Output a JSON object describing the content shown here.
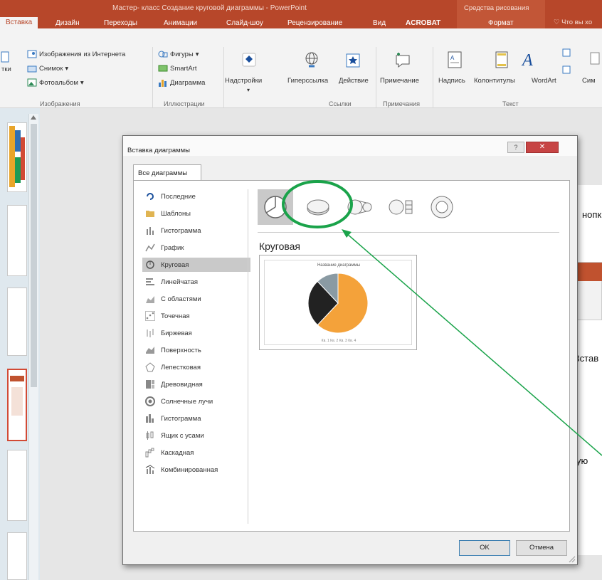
{
  "window": {
    "title": "Мастер- класс Создание круговой диаграммы - PowerPoint",
    "context_group": "Средства рисования",
    "tell_me": "Что вы хо"
  },
  "tabs": [
    {
      "label": "Вставка",
      "active": true
    },
    {
      "label": "Дизайн"
    },
    {
      "label": "Переходы"
    },
    {
      "label": "Анимации"
    },
    {
      "label": "Слайд-шоу"
    },
    {
      "label": "Рецензирование"
    },
    {
      "label": "Вид"
    },
    {
      "label": "ACROBAT"
    },
    {
      "label": "Формат"
    }
  ],
  "ribbon": {
    "images": {
      "online_pictures": "Изображения из Интернета",
      "screenshot": "Снимок",
      "photo_album": "Фотоальбом",
      "left_cut": "тки",
      "group": "Изображения"
    },
    "illustrations": {
      "shapes": "Фигуры",
      "smartart": "SmartArt",
      "chart": "Диаграмма",
      "group": "Иллюстрации"
    },
    "addins": {
      "label": "Надстройки"
    },
    "links": {
      "hyperlink": "Гиперссылка",
      "action": "Действие",
      "group": "Ссылки"
    },
    "comments": {
      "comment": "Примечание",
      "group": "Примечания"
    },
    "text": {
      "textbox": "Надпись",
      "header_footer": "Колонтитулы",
      "wordart": "WordArt",
      "symbols": "Сим",
      "group": "Текст"
    }
  },
  "slide": {
    "text1": "нопк",
    "text2": "Встав",
    "text3": "ую"
  },
  "dialog": {
    "title": "Вставка диаграммы",
    "help": "?",
    "close": "✕",
    "tab": "Все диаграммы",
    "categories": [
      {
        "label": "Последние",
        "icon": "recent-icon"
      },
      {
        "label": "Шаблоны",
        "icon": "folder-icon"
      },
      {
        "label": "Гистограмма",
        "icon": "column-chart-icon"
      },
      {
        "label": "График",
        "icon": "line-chart-icon"
      },
      {
        "label": "Круговая",
        "icon": "pie-chart-icon",
        "selected": true
      },
      {
        "label": "Линейчатая",
        "icon": "bar-chart-icon"
      },
      {
        "label": "С областями",
        "icon": "area-chart-icon"
      },
      {
        "label": "Точечная",
        "icon": "scatter-chart-icon"
      },
      {
        "label": "Биржевая",
        "icon": "stock-chart-icon"
      },
      {
        "label": "Поверхность",
        "icon": "surface-chart-icon"
      },
      {
        "label": "Лепестковая",
        "icon": "radar-chart-icon"
      },
      {
        "label": "Древовидная",
        "icon": "treemap-chart-icon"
      },
      {
        "label": "Солнечные лучи",
        "icon": "sunburst-chart-icon"
      },
      {
        "label": "Гистограмма",
        "icon": "histogram-chart-icon"
      },
      {
        "label": "Ящик с усами",
        "icon": "box-whisker-chart-icon"
      },
      {
        "label": "Каскадная",
        "icon": "waterfall-chart-icon"
      },
      {
        "label": "Комбинированная",
        "icon": "combo-chart-icon"
      }
    ],
    "subtypes": [
      "pie",
      "pie-3d",
      "pie-of-pie",
      "bar-of-pie",
      "doughnut"
    ],
    "selected_type": "Круговая",
    "preview": {
      "title": "Название диаграммы",
      "legend": "Кв. 1  Кв. 2  Кв. 3  Кв. 4",
      "slices": [
        {
          "value": 62,
          "color": "#f4a23a"
        },
        {
          "value": 26,
          "color": "#222222"
        },
        {
          "value": 12,
          "color": "#8a9aa3"
        }
      ]
    },
    "ok": "OK",
    "cancel": "Отмена"
  },
  "annotation": {
    "color": "#1aa34a"
  }
}
